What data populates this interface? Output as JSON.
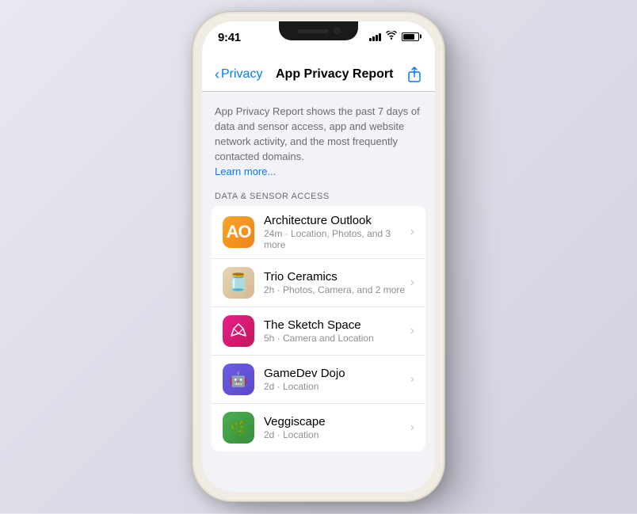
{
  "phone": {
    "status": {
      "time": "9:41",
      "signal_label": "signal",
      "wifi_label": "wifi",
      "battery_label": "battery"
    },
    "nav": {
      "back_label": "Privacy",
      "title": "App Privacy Report",
      "share_label": "share"
    },
    "description": {
      "text": "App Privacy Report shows the past 7 days of data and sensor access, app and website network activity, and the most frequently contacted domains.",
      "learn_more": "Learn more..."
    },
    "section": {
      "header": "DATA & SENSOR ACCESS"
    },
    "apps": [
      {
        "id": "architecture-outlook",
        "name": "Architecture Outlook",
        "detail": "24m · Location, Photos, and 3 more",
        "icon_text": "AO",
        "icon_class": "architecture"
      },
      {
        "id": "trio-ceramics",
        "name": "Trio Ceramics",
        "detail": "2h · Photos, Camera, and 2 more",
        "icon_text": "🫙",
        "icon_class": "ceramics"
      },
      {
        "id": "the-sketch-space",
        "name": "The Sketch Space",
        "detail": "5h · Camera and Location",
        "icon_text": "✦",
        "icon_class": "sketch"
      },
      {
        "id": "gamedev-dojo",
        "name": "GameDev Dojo",
        "detail": "2d · Location",
        "icon_text": "🤖",
        "icon_class": "gamedev"
      },
      {
        "id": "veggiscape",
        "name": "Veggiscape",
        "detail": "2d · Location",
        "icon_text": "🌿",
        "icon_class": "veggiscape"
      }
    ]
  }
}
